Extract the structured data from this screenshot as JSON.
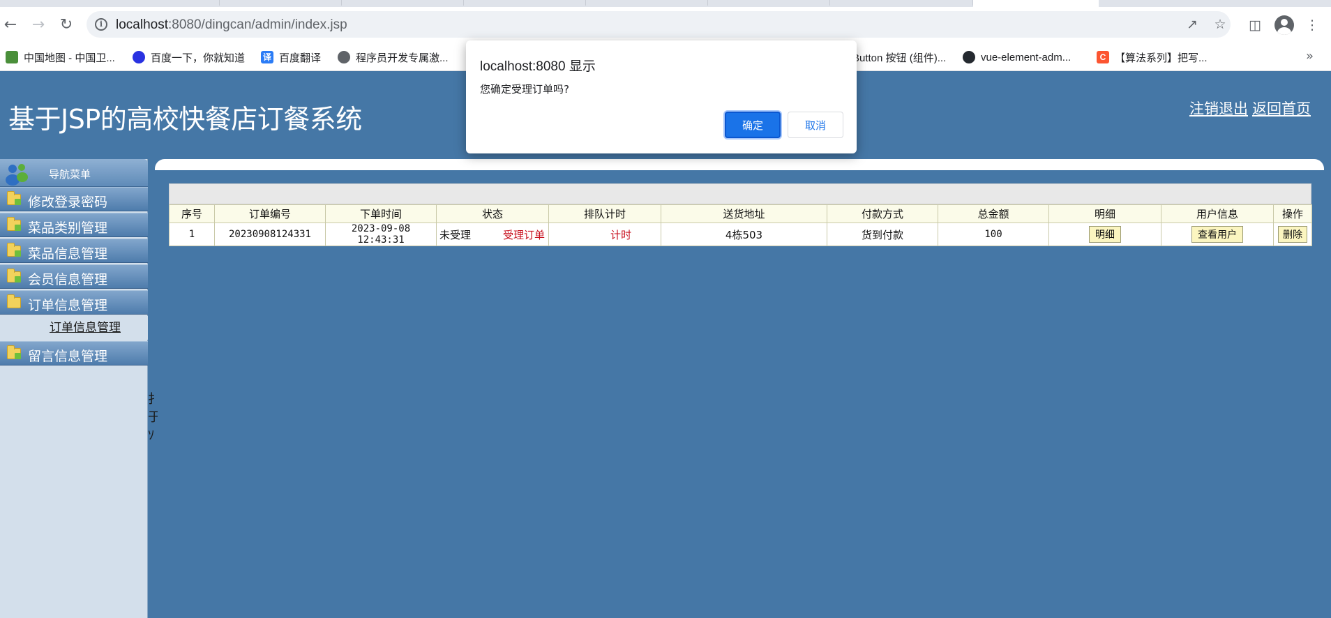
{
  "browser": {
    "url_host": "localhost",
    "url_rest": ":8080/dingcan/admin/index.jsp",
    "bookmarks": [
      {
        "label": "中国地图 - 中国卫...",
        "icon": "map-favicon",
        "color": "#4a8f3a"
      },
      {
        "label": "百度一下，你就知道",
        "icon": "baidu-paw-favicon",
        "color": "#2932e1"
      },
      {
        "label": "百度翻译",
        "icon": "baidu-translate-favicon",
        "color": "#2b7cf6"
      },
      {
        "label": "程序员开发专属激...",
        "icon": "globe-favicon",
        "color": "#5f6368"
      },
      {
        "label": "Button 按钮 (组件)...",
        "icon": "element-favicon",
        "color": "#409eff"
      },
      {
        "label": "vue-element-adm...",
        "icon": "github-favicon",
        "color": "#24292f"
      },
      {
        "label": "【算法系列】把写...",
        "icon": "csdn-favicon",
        "color": "#fc5531"
      }
    ],
    "more_label": "»"
  },
  "page": {
    "title": "基于JSP的高校快餐店订餐系统",
    "logout_label": "注销退出",
    "home_label": "返回首页",
    "bg_color": "#4577a6"
  },
  "sidebar": {
    "header": "导航菜单",
    "items": [
      {
        "label": "修改登录密码"
      },
      {
        "label": "菜品类别管理"
      },
      {
        "label": "菜品信息管理"
      },
      {
        "label": "会员信息管理"
      },
      {
        "label": "订单信息管理"
      },
      {
        "label": "留言信息管理"
      }
    ],
    "submenu_label": "订单信息管理",
    "cut_text": "扌 于 ｿ"
  },
  "table": {
    "headers": [
      "序号",
      "订单编号",
      "下单时间",
      "状态",
      "排队计时",
      "送货地址",
      "付款方式",
      "总金额",
      "明细",
      "用户信息",
      "操作"
    ],
    "rows": [
      {
        "index": "1",
        "order_no": "20230908124331",
        "time": "2023-09-08 12:43:31",
        "status": "未受理",
        "status_action": "受理订单",
        "timer": "计时",
        "address": "4栋503",
        "payment": "货到付款",
        "amount": "100",
        "detail_btn": "明细",
        "user_btn": "查看用户",
        "delete_btn": "删除"
      }
    ]
  },
  "dialog": {
    "title": "localhost:8080 显示",
    "message": "您确定受理订单吗?",
    "ok_label": "确定",
    "cancel_label": "取消",
    "accent": "#1a73e8"
  }
}
